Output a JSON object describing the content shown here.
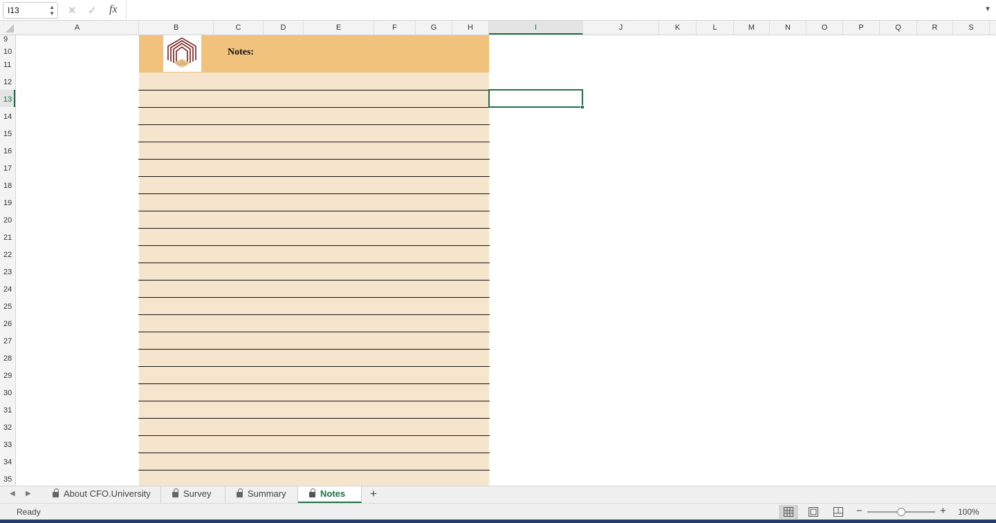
{
  "formula_bar": {
    "name_box": "I13",
    "formula": ""
  },
  "columns": [
    "A",
    "B",
    "C",
    "D",
    "E",
    "F",
    "G",
    "H",
    "I",
    "J",
    "K",
    "L",
    "M",
    "N",
    "O",
    "P",
    "Q",
    "R",
    "S"
  ],
  "active_column": "I",
  "rows": [
    "9",
    "10",
    "11",
    "12",
    "13",
    "14",
    "15",
    "16",
    "17",
    "18",
    "19",
    "20",
    "21",
    "22",
    "23",
    "24",
    "25",
    "26",
    "27",
    "28",
    "29",
    "30",
    "31",
    "32",
    "33",
    "34",
    "35"
  ],
  "active_row": "13",
  "notes": {
    "title": "Notes:"
  },
  "sheet_tabs": [
    {
      "label": "About CFO.University",
      "locked": true
    },
    {
      "label": "Survey",
      "locked": true
    },
    {
      "label": "Summary",
      "locked": true
    },
    {
      "label": "Notes",
      "locked": true,
      "active": true
    }
  ],
  "status_bar": {
    "status": "Ready",
    "zoom": "100%"
  },
  "colors": {
    "accent": "#1e7145",
    "notes_header": "#f0c27b",
    "notes_body": "#f5e5cd"
  }
}
